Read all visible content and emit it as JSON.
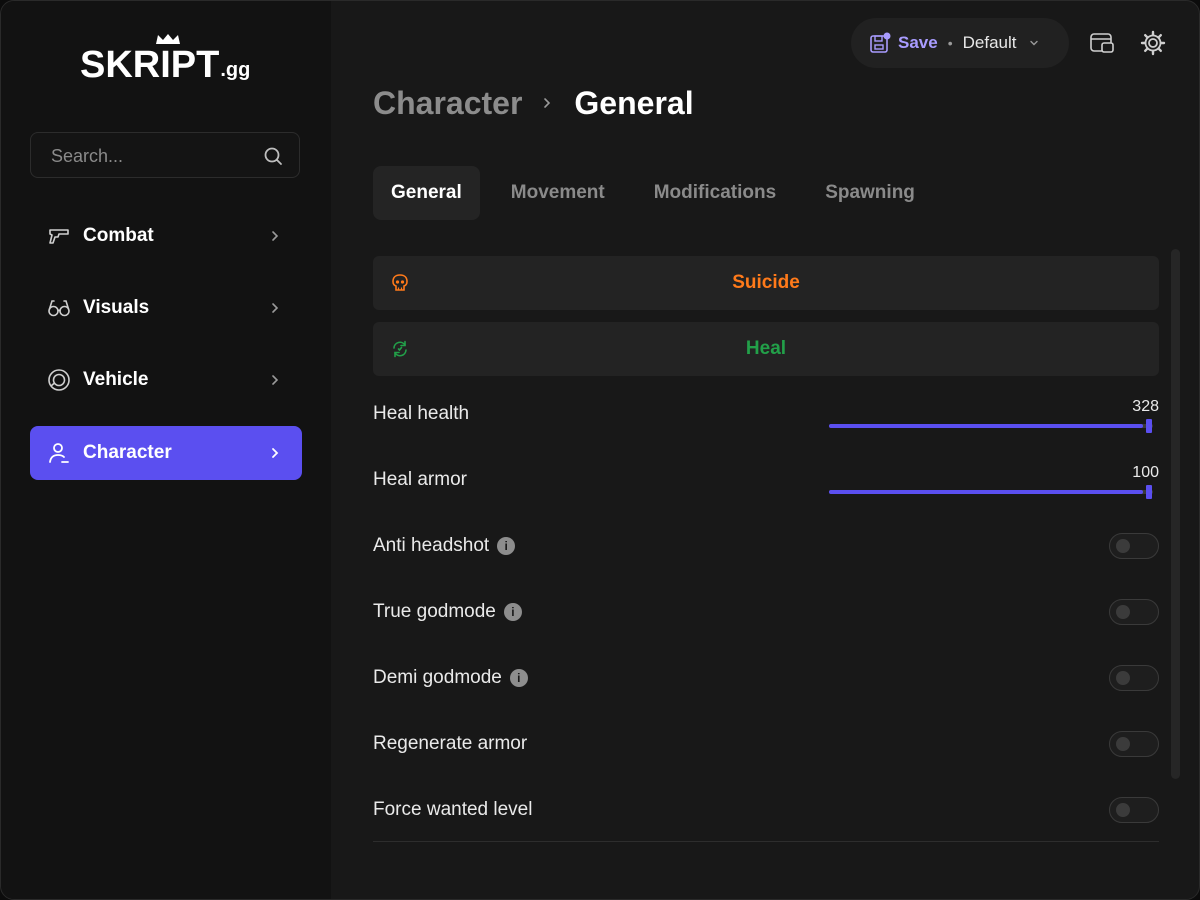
{
  "app": {
    "logo_text": "SKRIPT",
    "logo_suffix": ".gg"
  },
  "search": {
    "placeholder": "Search...",
    "value": ""
  },
  "sidebar": {
    "items": [
      {
        "label": "Combat",
        "icon": "pistol-icon",
        "active": false
      },
      {
        "label": "Visuals",
        "icon": "glasses-icon",
        "active": false
      },
      {
        "label": "Vehicle",
        "icon": "steering-wheel-icon",
        "active": false
      },
      {
        "label": "Character",
        "icon": "user-icon",
        "active": true
      }
    ]
  },
  "topbar": {
    "save_label": "Save",
    "separator": "•",
    "profile": "Default"
  },
  "breadcrumb": {
    "parent": "Character",
    "current": "General"
  },
  "tabs": [
    {
      "label": "General",
      "active": true
    },
    {
      "label": "Movement",
      "active": false
    },
    {
      "label": "Modifications",
      "active": false
    },
    {
      "label": "Spawning",
      "active": false
    }
  ],
  "actions": {
    "suicide": {
      "label": "Suicide",
      "icon": "skull-icon",
      "color": "#ff7a1a"
    },
    "heal": {
      "label": "Heal",
      "icon": "heal-refresh-icon",
      "color": "#22a049"
    }
  },
  "sliders": {
    "heal_health": {
      "label": "Heal health",
      "value": "328",
      "fraction": 0.97
    },
    "heal_armor": {
      "label": "Heal armor",
      "value": "100",
      "fraction": 0.97
    }
  },
  "toggles": {
    "anti_headshot": {
      "label": "Anti headshot",
      "info": true,
      "on": false
    },
    "true_godmode": {
      "label": "True godmode",
      "info": true,
      "on": false
    },
    "demi_godmode": {
      "label": "Demi godmode",
      "info": true,
      "on": false
    },
    "regenerate_armor": {
      "label": "Regenerate armor",
      "info": false,
      "on": false
    },
    "force_wanted_level": {
      "label": "Force wanted level",
      "info": false,
      "on": false
    }
  },
  "info_glyph": "i",
  "colors": {
    "accent": "#5b4ff0",
    "save_text": "#a99cff",
    "suicide": "#ff7a1a",
    "heal": "#22a049"
  }
}
